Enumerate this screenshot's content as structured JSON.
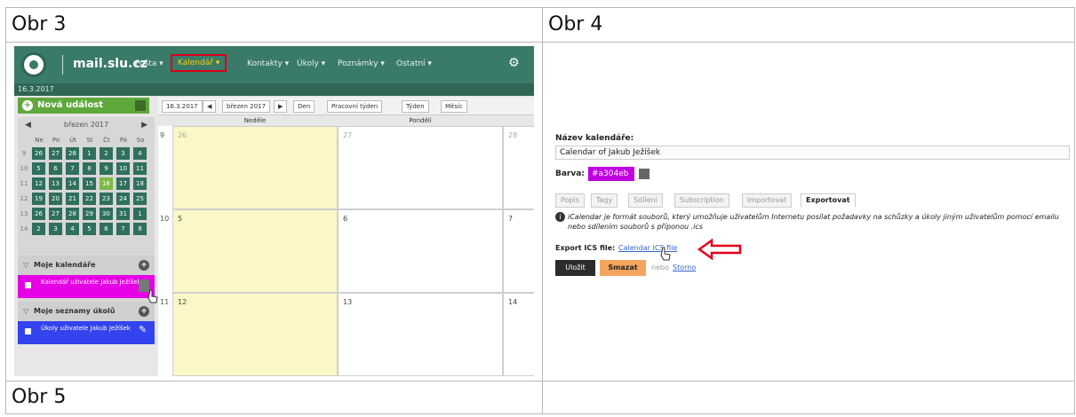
{
  "cells": {
    "fig3_title": "Obr 3",
    "fig4_title": "Obr 4",
    "fig5_title": "Obr 5"
  },
  "fig3": {
    "brand": "mail.slu.cz",
    "date": "16.3.2017",
    "menu": [
      "Pošta ▾",
      "Kalendář ▾",
      "Kontakty ▾",
      "Úkoly ▾",
      "Poznámky ▾",
      "Ostatní ▾"
    ],
    "new_event": "Nová událost",
    "mini_month": "březen 2017",
    "weekdays": [
      "Ne",
      "Po",
      "Út",
      "St",
      "Čt",
      "Pá",
      "So"
    ],
    "weeks": [
      {
        "wk": "9",
        "days": [
          "26",
          "27",
          "28",
          "1",
          "2",
          "3",
          "4"
        ]
      },
      {
        "wk": "10",
        "days": [
          "5",
          "6",
          "7",
          "8",
          "9",
          "10",
          "11"
        ]
      },
      {
        "wk": "11",
        "days": [
          "12",
          "13",
          "14",
          "15",
          "16",
          "17",
          "18"
        ]
      },
      {
        "wk": "12",
        "days": [
          "19",
          "20",
          "21",
          "22",
          "23",
          "24",
          "25"
        ]
      },
      {
        "wk": "13",
        "days": [
          "26",
          "27",
          "28",
          "29",
          "30",
          "31",
          "1"
        ]
      },
      {
        "wk": "14",
        "days": [
          "2",
          "3",
          "4",
          "5",
          "6",
          "7",
          "8"
        ]
      }
    ],
    "today": "16",
    "my_calendars": "Moje kalendáře",
    "calendar_item": "Kalendář uživatele Jakub Ježíšek",
    "my_tasks": "Moje seznamy úkolů",
    "tasks_item": "Úkoly uživatele Jakub Ježíšek",
    "toolbar": {
      "date": "16.3.2017",
      "month": "březen 2017",
      "day": "Den",
      "workweek": "Pracovní týden",
      "week": "Týden",
      "month_view": "Měsíc"
    },
    "columns": [
      "Neděle",
      "Pondělí"
    ],
    "rows": [
      {
        "wk": "9",
        "days": [
          "26",
          "27",
          "28"
        ]
      },
      {
        "wk": "10",
        "days": [
          "5",
          "6",
          "7"
        ]
      },
      {
        "wk": "11",
        "days": [
          "12",
          "13",
          "14"
        ]
      }
    ],
    "colors": {
      "header": "#3a7a68",
      "green_cell": "#2f6f5e",
      "today": "#7dbb43",
      "calendar": "#e600e6",
      "tasks": "#3344ee",
      "arrow": "#e3001b"
    }
  },
  "fig4": {
    "name_label": "Název kalendáře:",
    "name_value": "Calendar of Jakub Ježíšek",
    "color_label": "Barva:",
    "color_value": "#a304eb",
    "tabs": [
      "Popis",
      "Tagy",
      "Sdílení",
      "Subscription",
      "Importovat",
      "Exportovat"
    ],
    "info": "iCalendar je formát souborů, který umožňuje uživatelům Internetu posílat požadavky na schůzky a úkoly jiným uživatelům pomocí emailu nebo sdílením souborů s příponou .ics",
    "export_label": "Export ICS file:",
    "export_link": "Calendar ICS file",
    "save": "Uložit",
    "delete": "Smazat",
    "or": "nebo",
    "cancel": "Storno"
  }
}
